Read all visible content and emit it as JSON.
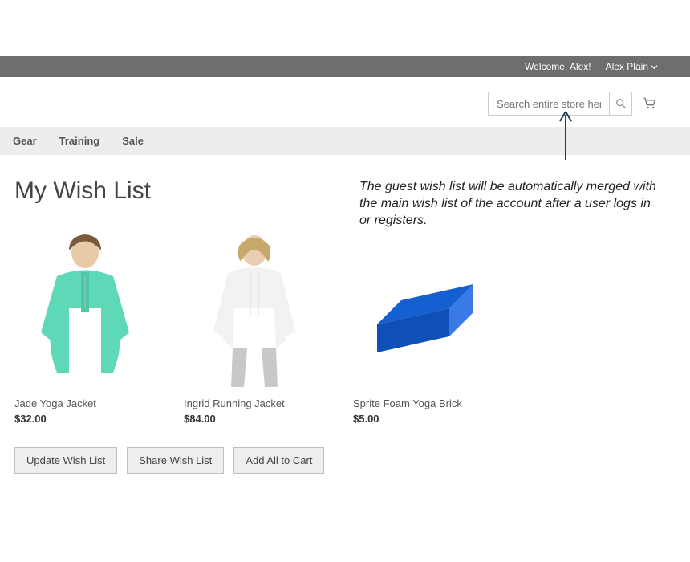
{
  "topbar": {
    "welcome": "Welcome, Alex!",
    "account_name": "Alex Plain"
  },
  "search": {
    "placeholder": "Search entire store here..."
  },
  "nav": {
    "items": [
      "Gear",
      "Training",
      "Sale"
    ]
  },
  "page": {
    "title": "My Wish List"
  },
  "annotation": {
    "text": "The guest wish list will be automatically merged with the main wish list of the account after a user logs in or registers."
  },
  "products": [
    {
      "name": "Jade Yoga Jacket",
      "price": "$32.00"
    },
    {
      "name": "Ingrid Running Jacket",
      "price": "$84.00"
    },
    {
      "name": "Sprite Foam Yoga Brick",
      "price": "$5.00"
    }
  ],
  "actions": {
    "update": "Update Wish List",
    "share": "Share Wish List",
    "add_all": "Add All to Cart"
  }
}
